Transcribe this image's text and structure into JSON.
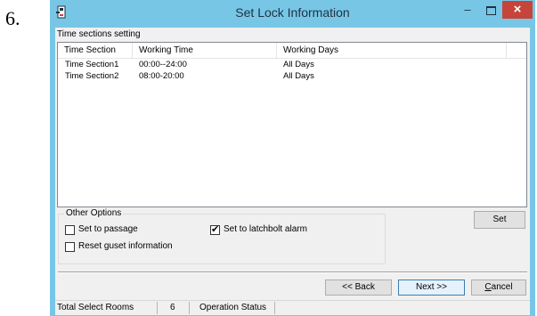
{
  "step": {
    "number": "6."
  },
  "window": {
    "title": "Set Lock Information",
    "minimize_glyph": "–",
    "close_glyph": "×"
  },
  "time_sections": {
    "label": "Time sections setting",
    "columns": [
      "Time Section",
      "Working Time",
      "Working Days"
    ],
    "rows": [
      {
        "section": "Time Section1",
        "time": "00:00--24:00",
        "days": "All Days"
      },
      {
        "section": "Time Section2",
        "time": "08:00-20:00",
        "days": "All Days"
      }
    ]
  },
  "other_options": {
    "title": "Other Options",
    "set_to_passage": {
      "label": "Set to passage",
      "checked": false
    },
    "set_to_latchbolt_alarm": {
      "label": "Set to latchbolt alarm",
      "checked": true
    },
    "reset_guest_information": {
      "label": "Reset guset information",
      "checked": false
    }
  },
  "buttons": {
    "set": "Set",
    "back": "<< Back",
    "next": "Next >>",
    "cancel_accel": "C",
    "cancel_rest": "ancel"
  },
  "status_bar": {
    "total_label": "Total Select Rooms",
    "total_count": "6",
    "operation_label": "Operation Status"
  },
  "colors": {
    "title_bar": "#77c6e6",
    "close_button": "#c7443a"
  }
}
